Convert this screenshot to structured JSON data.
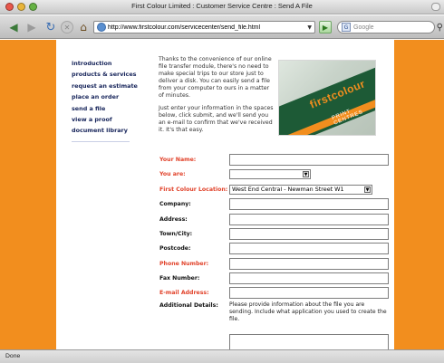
{
  "window": {
    "title": "First Colour Limited : Customer Service Centre : Send A File"
  },
  "toolbar": {
    "url": "http://www.firstcolour.com/servicecenter/send_file.html",
    "search_placeholder": "Google",
    "google_icon_letter": "G"
  },
  "nav": {
    "items": [
      {
        "label": "introduction"
      },
      {
        "label": "products & services"
      },
      {
        "label": "request an estimate"
      },
      {
        "label": "place an order"
      },
      {
        "label": "send a file"
      },
      {
        "label": "view a proof"
      },
      {
        "label": "document library"
      }
    ]
  },
  "intro": {
    "para1": "Thanks to the convenience of our online file transfer module, there's no need to make special trips to our store just to deliver a disk. You can easily send a file from your computer to ours in a matter of minutes.",
    "para2": "Just enter your information in the spaces below, click submit, and we'll send you an e-mail to confirm that we've received it. It's that easy."
  },
  "photo": {
    "brand": "firstcolour",
    "sub": "PRINT CENTRES"
  },
  "form": {
    "your_name": "Your Name:",
    "you_are": "You are:",
    "you_are_value": "",
    "location": "First Colour Location:",
    "location_value": "West End Central - Newman Street W1",
    "company": "Company:",
    "address": "Address:",
    "town": "Town/City:",
    "postcode": "Postcode:",
    "phone": "Phone Number:",
    "fax": "Fax Number:",
    "email": "E-mail Address:",
    "additional": "Additional Details:",
    "additional_help": "Please provide information about the file you are sending. Include what application you used to create the file."
  },
  "status": {
    "text": "Done"
  },
  "colors": {
    "accent_orange": "#f28e1e",
    "nav_text": "#16245a",
    "required_label": "#e1422a"
  }
}
